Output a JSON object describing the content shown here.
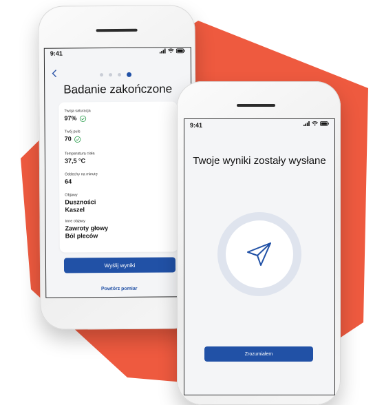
{
  "colors": {
    "background_shape": "#ee5a3f",
    "accent": "#2151a6",
    "success": "#3aa55a"
  },
  "phone_left": {
    "status": {
      "time": "9:41",
      "icons": [
        "signal-icon",
        "wifi-icon",
        "battery-icon"
      ]
    },
    "back_icon": "chevron-left-icon",
    "step_dots": {
      "total": 4,
      "active": 4
    },
    "title": "Badanie zakończone",
    "fields": [
      {
        "label": "Twoja saturacja",
        "value": "97%",
        "icon": "check-circle-icon"
      },
      {
        "label": "Twój puls",
        "value": "70",
        "icon": "check-circle-icon"
      },
      {
        "label": "Temperatura ciała",
        "value": "37,5 °C"
      },
      {
        "label": "Oddechy na minutę",
        "value": "64"
      },
      {
        "label": "Objawy",
        "value_lines": [
          "Duszności",
          "Kaszel"
        ]
      },
      {
        "label": "Inne objawy",
        "value_lines": [
          "Zawroty głowy",
          "Ból pleców"
        ]
      }
    ],
    "send_button": "Wyślij wyniki",
    "repeat_link": "Powtórz pomiar"
  },
  "phone_right": {
    "status": {
      "time": "9:41",
      "icons": [
        "signal-icon",
        "wifi-icon",
        "battery-icon"
      ]
    },
    "title": "Twoje wyniki zostały wysłane",
    "send_icon": "paper-plane-icon",
    "confirm_button": "Zrozumiałem"
  }
}
